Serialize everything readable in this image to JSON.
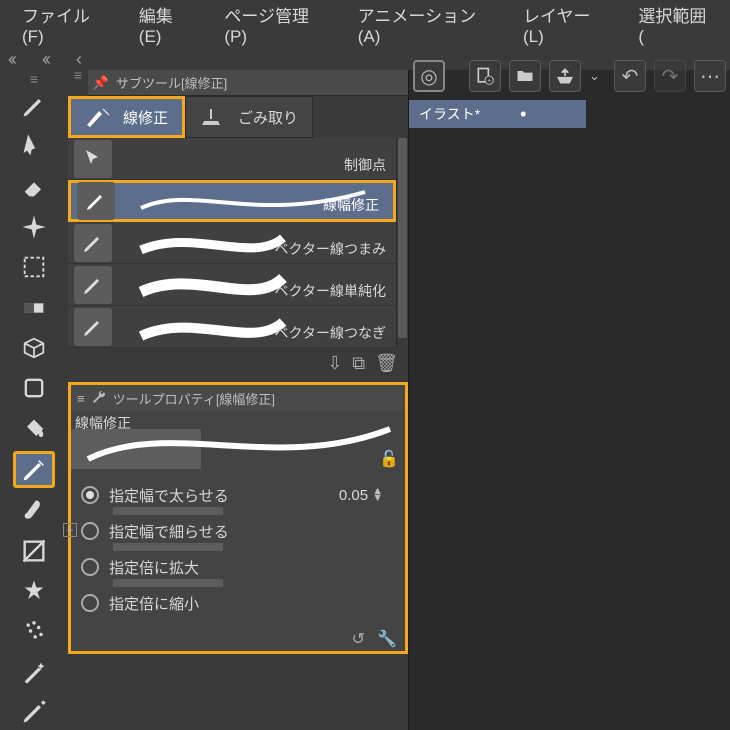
{
  "menu": {
    "file": "ファイル(F)",
    "edit": "編集(E)",
    "page": "ページ管理(P)",
    "anim": "アニメーション(A)",
    "layer": "レイヤー(L)",
    "select": "選択範囲("
  },
  "subtool_panel_title": "サブツール[線修正]",
  "tabs": {
    "line_correct": "線修正",
    "dust": "ごみ取り"
  },
  "subtools": [
    {
      "label": "制御点"
    },
    {
      "label": "線幅修正"
    },
    {
      "label": "ベクター線つまみ"
    },
    {
      "label": "ベクター線単純化"
    },
    {
      "label": "ベクター線つなぎ"
    }
  ],
  "toolprop": {
    "title": "ツールプロパティ[線幅修正]",
    "heading": "線幅修正",
    "options": {
      "thicken": "指定幅で太らせる",
      "thin": "指定幅で細らせる",
      "scaleup": "指定倍に拡大",
      "scaledown": "指定倍に縮小"
    },
    "value": "0.05"
  },
  "doc_tab": "イラスト*",
  "colors": {
    "highlight": "#f4a91c",
    "select_bg": "#5d6d8c"
  }
}
